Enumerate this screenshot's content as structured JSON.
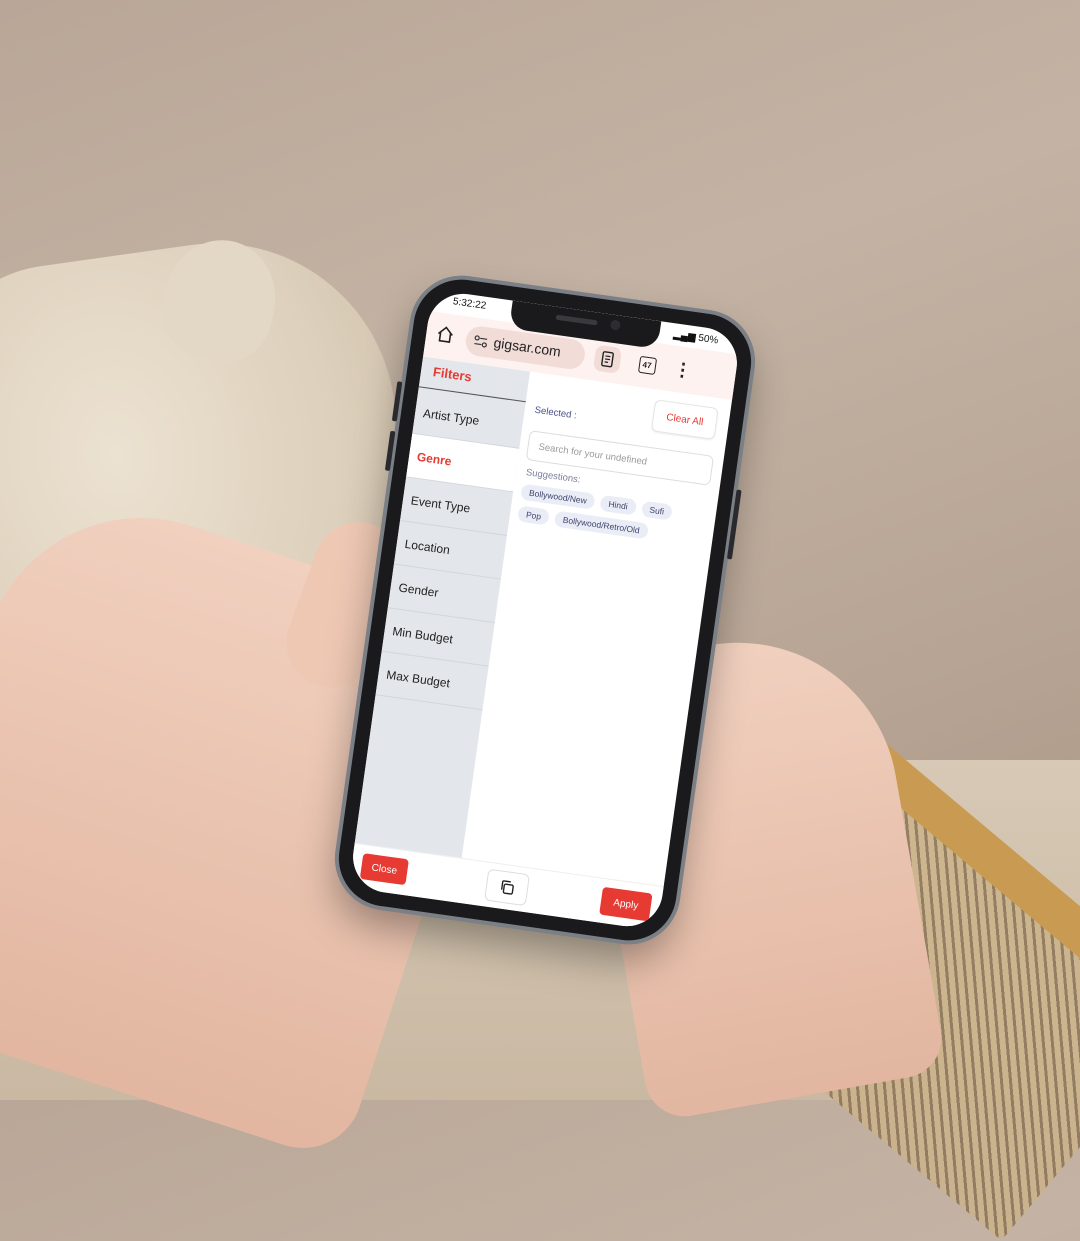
{
  "status_bar": {
    "time": "5:32:22",
    "battery": "50%"
  },
  "browser": {
    "url": "gigsar.com",
    "tab_count": "47",
    "menu_glyph": "⋮"
  },
  "filters": {
    "title": "Filters",
    "categories": [
      {
        "label": "Artist Type"
      },
      {
        "label": "Genre",
        "active": true
      },
      {
        "label": "Event Type"
      },
      {
        "label": "Location"
      },
      {
        "label": "Gender"
      },
      {
        "label": "Min Budget"
      },
      {
        "label": "Max Budget"
      }
    ],
    "clear_all_label": "Clear All",
    "selected_label": "Selected :",
    "search_placeholder": "Search for your undefined",
    "suggestions_label": "Suggestions:",
    "suggestions": [
      "Bollywood/New",
      "Hindi",
      "Sufi",
      "Pop",
      "Bollywood/Retro/Old"
    ]
  },
  "footer": {
    "close_label": "Close",
    "apply_label": "Apply"
  },
  "colors": {
    "accent": "#e63a32",
    "sidebar_bg": "#e3e6ea",
    "chip_bg": "#eaedf5"
  }
}
